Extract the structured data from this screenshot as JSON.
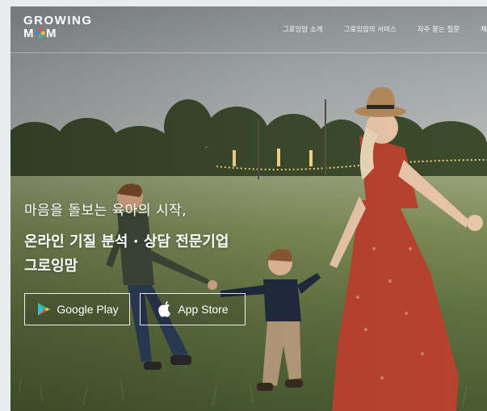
{
  "header": {
    "logo_line1": "GROWING",
    "logo_line2_prefix": "M",
    "logo_line2_suffix": "M",
    "nav": [
      {
        "label": "그로잉맘 소개"
      },
      {
        "label": "그로잉맘의 서비스"
      },
      {
        "label": "자주 묻는 질문"
      },
      {
        "label": "체"
      }
    ]
  },
  "hero": {
    "subtitle": "마음을 돌보는 육아의 시작,",
    "title_line1": "온라인 기질 분석 · 상담 전문기업",
    "title_line2": "그로잉맘"
  },
  "store_buttons": {
    "google_play_label": "Google Play",
    "app_store_label": "App Store"
  },
  "colors": {
    "logo_mark_red": "#e8504a",
    "logo_mark_yellow": "#f6c344",
    "logo_mark_green": "#4fb882",
    "logo_mark_blue": "#3f88d6",
    "text": "#ffffff"
  },
  "icons": {
    "google_play": "google-play-icon",
    "app_store": "apple-icon"
  }
}
